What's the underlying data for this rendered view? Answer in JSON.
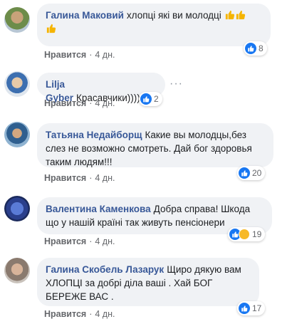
{
  "comments": [
    {
      "author": "Галина Маковий",
      "text": "хлопці які ви молодці",
      "emoji": "thumbs-up thumbs-up thumbs-up",
      "like_label": "Нравится",
      "time": "4 дн.",
      "reaction_count": "8"
    },
    {
      "author": "Lilja Gyber",
      "text": "Красавчики))))",
      "like_label": "Нравится",
      "time": "4 дн.",
      "reaction_count": "2",
      "more_label": "···"
    },
    {
      "author": "Татьяна Недайборщ",
      "text": "Какие вы молодцы,без слез не возможно смотреть. Дай бог здоровья таким людям!!!",
      "like_label": "Нравится",
      "time": "4 дн.",
      "reaction_count": "20"
    },
    {
      "author": "Валентина Каменкова",
      "text": "Добра справа! Шкода що у нашій країні так живуть пенсіонери",
      "like_label": "Нравится",
      "time": "4 дн.",
      "reaction_count": "19"
    },
    {
      "author": "Галина Скобель Лазарук",
      "text": "Щиро дякую вам ХЛОПЦІ за добрі діла ваші . Хай БОГ БЕРЕЖЕ ВАС .",
      "like_label": "Нравится",
      "time": "4 дн.",
      "reaction_count": "17"
    }
  ],
  "separator": "·",
  "colors": {
    "bubble": "#f0f2f5",
    "author": "#385898",
    "meta": "#65676b",
    "like_blue": "#1877f2",
    "sad_yellow": "#f7b928"
  }
}
